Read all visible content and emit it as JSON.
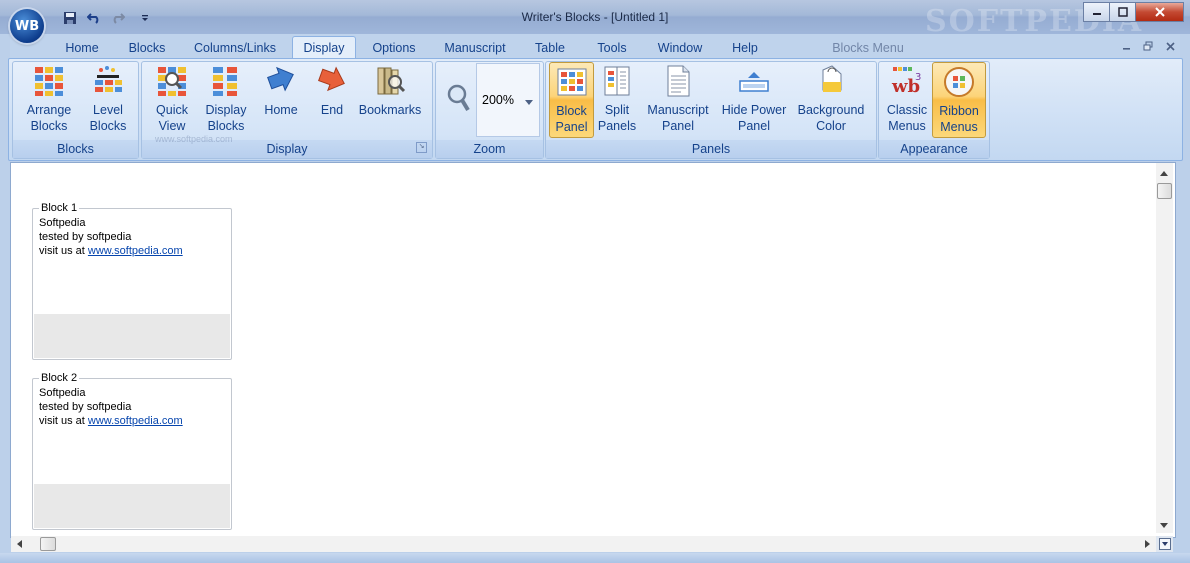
{
  "window": {
    "title": "Writer's Blocks - [Untitled 1]",
    "app_orb": "WB",
    "watermark": "SOFTPEDIA"
  },
  "qat": {
    "save_icon": "save-icon",
    "undo_icon": "undo-icon",
    "redo_icon": "redo-icon",
    "customize_icon": "customize-qat-icon"
  },
  "tabs": [
    {
      "label": "Home"
    },
    {
      "label": "Blocks"
    },
    {
      "label": "Columns/Links"
    },
    {
      "label": "Display",
      "active": true
    },
    {
      "label": "Options"
    },
    {
      "label": "Manuscript"
    },
    {
      "label": "Table"
    },
    {
      "label": "Tools"
    },
    {
      "label": "Window"
    },
    {
      "label": "Help"
    }
  ],
  "blocks_menu_label": "Blocks Menu",
  "ribbon": {
    "groups": {
      "blocks": "Blocks",
      "display": "Display",
      "zoom": "Zoom",
      "panels": "Panels",
      "appearance": "Appearance"
    },
    "buttons": {
      "arrange_blocks": {
        "line1": "Arrange",
        "line2": "Blocks"
      },
      "level_blocks": {
        "line1": "Level",
        "line2": "Blocks"
      },
      "quick_view": {
        "line1": "Quick",
        "line2": "View"
      },
      "display_blocks": {
        "line1": "Display",
        "line2": "Blocks"
      },
      "home": {
        "line1": "Home",
        "line2": ""
      },
      "end": {
        "line1": "End",
        "line2": ""
      },
      "bookmarks": {
        "line1": "Bookmarks",
        "line2": ""
      },
      "block_panel": {
        "line1": "Block",
        "line2": "Panel",
        "active": true
      },
      "split_panels": {
        "line1": "Split",
        "line2": "Panels"
      },
      "manuscript_panel": {
        "line1": "Manuscript",
        "line2": "Panel"
      },
      "hide_power_panel": {
        "line1": "Hide Power",
        "line2": "Panel"
      },
      "background_color": {
        "line1": "Background",
        "line2": "Color"
      },
      "classic_menus": {
        "line1": "Classic",
        "line2": "Menus"
      },
      "ribbon_menus": {
        "line1": "Ribbon",
        "line2": "Menus",
        "active": true
      }
    },
    "zoom_value": "200%",
    "watermark_small": "www.softpedia.com"
  },
  "blocks": [
    {
      "title": "Block 1",
      "line1": "Softpedia",
      "line2": "tested by softpedia",
      "line3_prefix": "visit us at ",
      "link": "www.softpedia.com"
    },
    {
      "title": "Block 2",
      "line1": "Softpedia",
      "line2": "tested by softpedia",
      "line3_prefix": "visit us at ",
      "link": "www.softpedia.com"
    }
  ],
  "colors": {
    "ribbon_bg": "#cfe0f5",
    "active_orange": "#f9bd47",
    "tab_text": "#15428b",
    "link": "#0645ad"
  }
}
